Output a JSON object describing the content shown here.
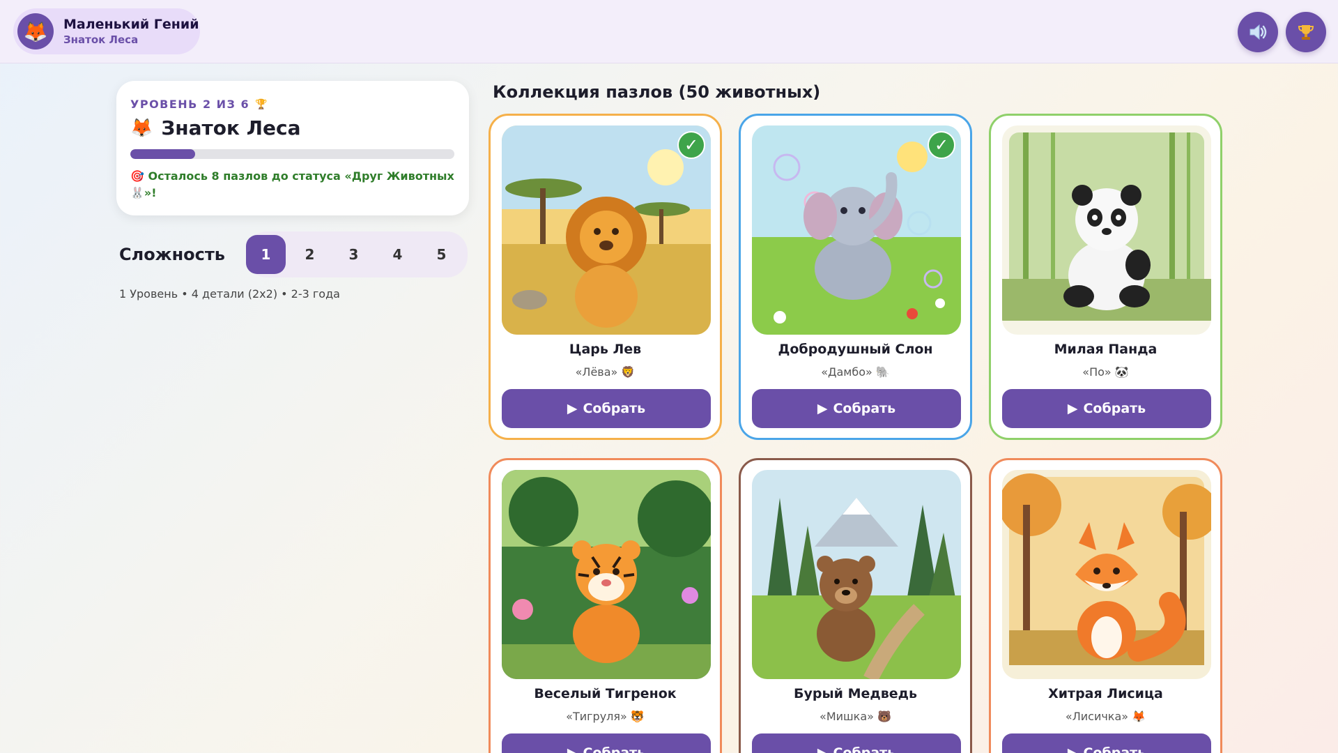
{
  "header": {
    "profile_name": "Маленький Гений",
    "profile_rank": "Знаток Леса",
    "avatar_emoji": "🦊",
    "sound_icon": "speaker-icon",
    "trophy_icon": "trophy-icon"
  },
  "level": {
    "kicker": "УРОВЕНЬ 2 ИЗ 6",
    "kicker_emoji": "🏆",
    "title": "Знаток Леса",
    "title_emoji": "🦊",
    "progress_fraction": 0.2,
    "note": "🎯 Осталось 8 пазлов до статуса «Друг Животных 🐰»!"
  },
  "difficulty": {
    "label": "Сложность",
    "levels": [
      "1",
      "2",
      "3",
      "4",
      "5"
    ],
    "selected": "1",
    "caption": "1 Уровень • 4 детали (2x2) • 2-3 года"
  },
  "collection": {
    "title": "Коллекция пазлов (50 животных)",
    "button_label": "Собрать",
    "cards": [
      {
        "name": "Царь Лев",
        "nick": "«Лёва» 🦁",
        "completed": true,
        "border": "#f5b04a",
        "animal": "lion"
      },
      {
        "name": "Добродушный Слон",
        "nick": "«Дамбо» 🐘",
        "completed": true,
        "border": "#4aa5e8",
        "animal": "elephant"
      },
      {
        "name": "Милая Панда",
        "nick": "«По» 🐼",
        "completed": false,
        "border": "#8fd06a",
        "animal": "panda"
      },
      {
        "name": "Веселый Тигренок",
        "nick": "«Тигруля» 🐯",
        "completed": false,
        "border": "#f08a5a",
        "animal": "tiger"
      },
      {
        "name": "Бурый Медведь",
        "nick": "«Мишка» 🐻",
        "completed": false,
        "border": "#8a5a4a",
        "animal": "bear"
      },
      {
        "name": "Хитрая Лисица",
        "nick": "«Лисичка» 🦊",
        "completed": false,
        "border": "#f08a5a",
        "animal": "fox"
      }
    ]
  }
}
